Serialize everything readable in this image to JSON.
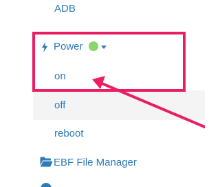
{
  "menu": {
    "adb_label": "ADB",
    "power_label": "Power",
    "power_icon": "bolt-icon",
    "power_status_color": "#8bd46e",
    "power_options": [
      {
        "label": "on"
      },
      {
        "label": "off"
      },
      {
        "label": "reboot"
      }
    ],
    "file_manager_label": "EBF File Manager",
    "file_manager_icon": "folder-open-icon"
  },
  "colors": {
    "link": "#2e7bb8",
    "hover_bg": "#f4f4f4",
    "annotation": "#e91e63"
  }
}
